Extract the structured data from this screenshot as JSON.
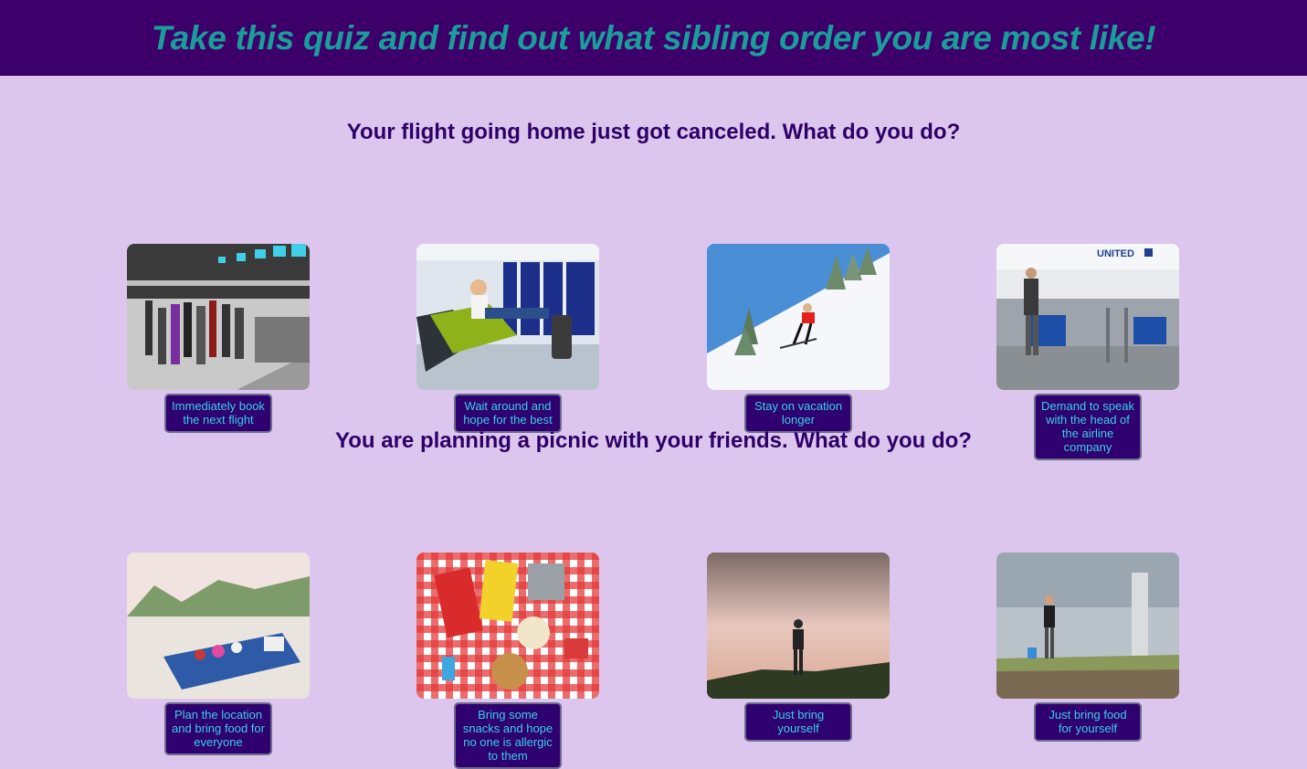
{
  "header": {
    "title": "Take this quiz and find out what sibling order you are most like!"
  },
  "questions": [
    {
      "text": "Your flight going home just got canceled. What do you do?",
      "options": [
        {
          "label": "Immediately book the next flight",
          "image": "airport-check-in-crowd"
        },
        {
          "label": "Wait around and hope for the best",
          "image": "woman-waiting-in-terminal"
        },
        {
          "label": "Stay on vacation longer",
          "image": "skier-on-snowy-slope"
        },
        {
          "label": "Demand to speak with the head of the airline company",
          "image": "united-airlines-counter",
          "image_text": "UNITED"
        }
      ]
    },
    {
      "text": "You are planning a picnic with your friends. What do you do?",
      "options": [
        {
          "label": "Plan the location and bring food for everyone",
          "image": "beach-picnic-blanket"
        },
        {
          "label": "Bring some snacks and hope no one is allergic to them",
          "image": "snacks-on-checkered-tablecloth"
        },
        {
          "label": "Just bring yourself",
          "image": "person-walking-on-hill-at-sunset"
        },
        {
          "label": "Just bring food for yourself",
          "image": "man-carrying-food-on-beach"
        }
      ]
    }
  ],
  "colors": {
    "page_background": "#dcc6ee",
    "header_background": "#3d006b",
    "title_text": "#1a9e9a",
    "question_text": "#2e0067",
    "button_background": "#2e0070",
    "button_text": "#39d1e6"
  }
}
